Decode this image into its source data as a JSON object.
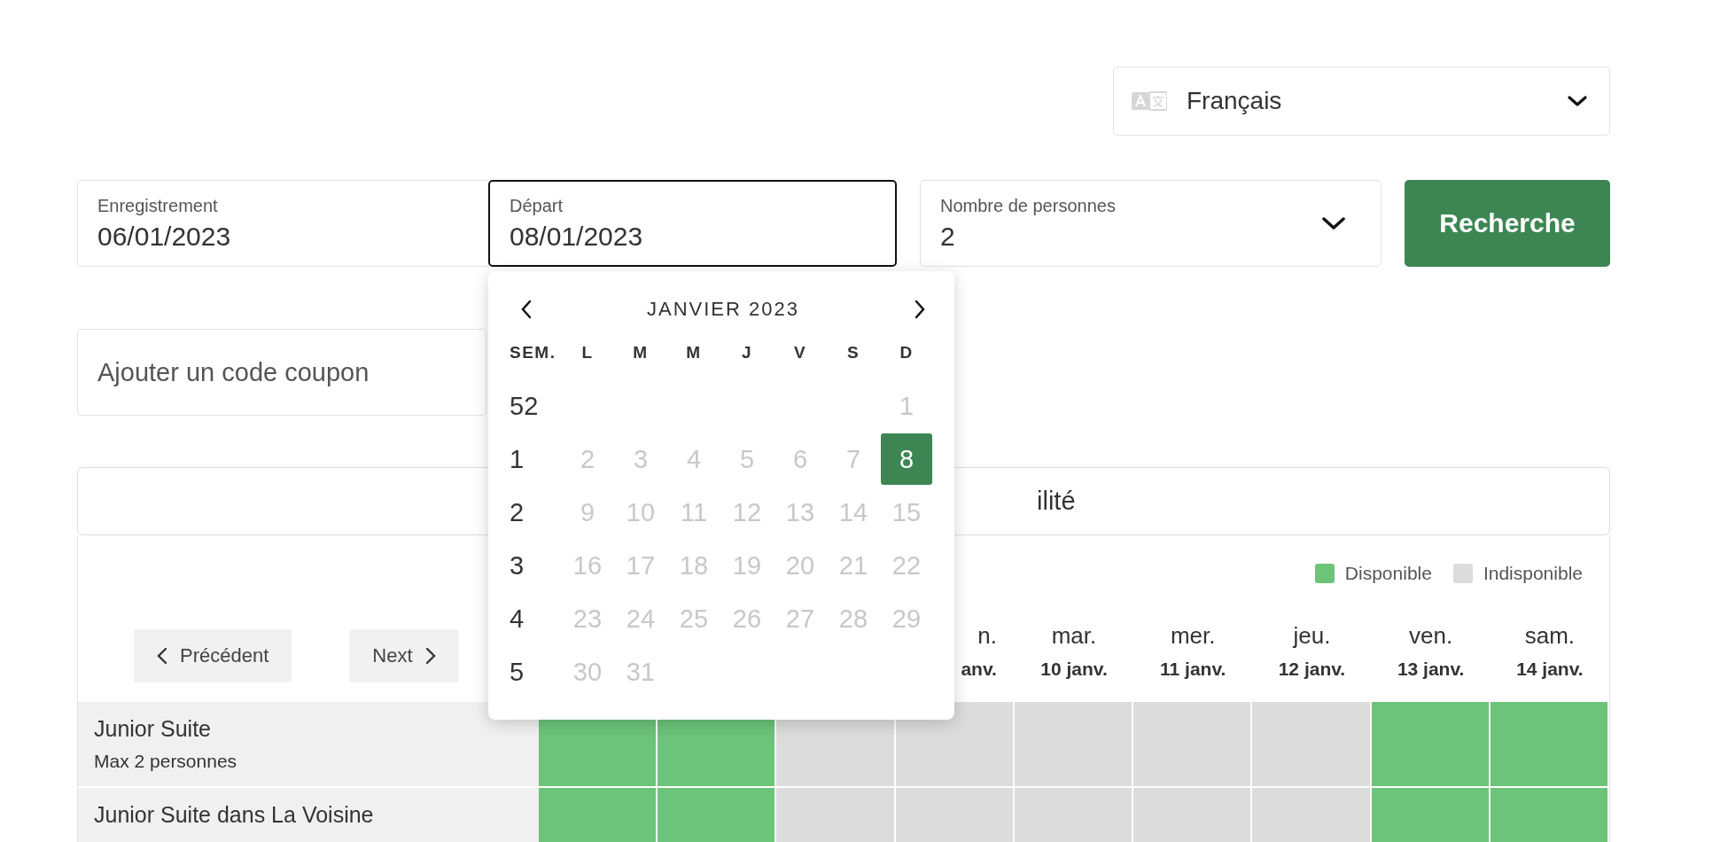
{
  "language": {
    "value": "Français"
  },
  "search_form": {
    "checkin": {
      "label": "Enregistrement",
      "value": "06/01/2023"
    },
    "checkout": {
      "label": "Départ",
      "value": "08/01/2023",
      "focused": true
    },
    "guests": {
      "label": "Nombre de personnes",
      "value": "2"
    },
    "search_button": "Recherche"
  },
  "coupon": {
    "placeholder": "Ajouter un code coupon"
  },
  "date_picker": {
    "month": "JANVIER 2023",
    "week_header": "SEM.",
    "weekdays": [
      "L",
      "M",
      "M",
      "J",
      "V",
      "S",
      "D"
    ],
    "weeks": [
      {
        "week": "52",
        "days": [
          {
            "day": "1",
            "disabled": true,
            "selected": false
          }
        ]
      },
      {
        "week": "1",
        "days": [
          {
            "day": "2",
            "disabled": true,
            "selected": false
          },
          {
            "day": "3",
            "disabled": true,
            "selected": false
          },
          {
            "day": "4",
            "disabled": true,
            "selected": false
          },
          {
            "day": "5",
            "disabled": true,
            "selected": false
          },
          {
            "day": "6",
            "disabled": true,
            "selected": false
          },
          {
            "day": "7",
            "disabled": true,
            "selected": false
          },
          {
            "day": "8",
            "disabled": false,
            "selected": true
          }
        ]
      },
      {
        "week": "2",
        "days": [
          {
            "day": "9",
            "disabled": true,
            "selected": false
          },
          {
            "day": "10",
            "disabled": true,
            "selected": false
          },
          {
            "day": "11",
            "disabled": true,
            "selected": false
          },
          {
            "day": "12",
            "disabled": true,
            "selected": false
          },
          {
            "day": "13",
            "disabled": true,
            "selected": false
          },
          {
            "day": "14",
            "disabled": true,
            "selected": false
          },
          {
            "day": "15",
            "disabled": true,
            "selected": false
          }
        ]
      },
      {
        "week": "3",
        "days": [
          {
            "day": "16",
            "disabled": true,
            "selected": false
          },
          {
            "day": "17",
            "disabled": true,
            "selected": false
          },
          {
            "day": "18",
            "disabled": true,
            "selected": false
          },
          {
            "day": "19",
            "disabled": true,
            "selected": false
          },
          {
            "day": "20",
            "disabled": true,
            "selected": false
          },
          {
            "day": "21",
            "disabled": true,
            "selected": false
          },
          {
            "day": "22",
            "disabled": true,
            "selected": false
          }
        ]
      },
      {
        "week": "4",
        "days": [
          {
            "day": "23",
            "disabled": true,
            "selected": false
          },
          {
            "day": "24",
            "disabled": true,
            "selected": false
          },
          {
            "day": "25",
            "disabled": true,
            "selected": false
          },
          {
            "day": "26",
            "disabled": true,
            "selected": false
          },
          {
            "day": "27",
            "disabled": true,
            "selected": false
          },
          {
            "day": "28",
            "disabled": true,
            "selected": false
          },
          {
            "day": "29",
            "disabled": true,
            "selected": false
          }
        ]
      },
      {
        "week": "5",
        "days": [
          {
            "day": "30",
            "disabled": true,
            "selected": false
          },
          {
            "day": "31",
            "disabled": true,
            "selected": false
          }
        ]
      }
    ]
  },
  "availability_bar": {
    "title": "ilité"
  },
  "availability": {
    "legend": [
      {
        "label": "Disponible",
        "color": "#6cc37a"
      },
      {
        "label": "Indisponible",
        "color": "#dcdcdc"
      }
    ],
    "previous_button": "Précédent",
    "next_button": "Next",
    "days": [
      {
        "weekday": "n.",
        "date": "anv."
      },
      {
        "weekday": "mar.",
        "date": "10 janv."
      },
      {
        "weekday": "mer.",
        "date": "11 janv."
      },
      {
        "weekday": "jeu.",
        "date": "12 janv."
      },
      {
        "weekday": "ven.",
        "date": "13 janv."
      },
      {
        "weekday": "sam.",
        "date": "14 janv."
      }
    ],
    "rooms": [
      {
        "name": "Junior Suite",
        "capacity": "Max 2 personnes",
        "cells": [
          {
            "available": true
          },
          {
            "available": true
          },
          {
            "available": false
          },
          {
            "available": false
          },
          {
            "available": false
          },
          {
            "available": false
          },
          {
            "available": false
          },
          {
            "available": true
          },
          {
            "available": true
          }
        ]
      },
      {
        "name": "Junior Suite dans La Voisine",
        "cells": [
          {
            "available": true
          },
          {
            "available": true
          },
          {
            "available": false
          },
          {
            "available": false
          },
          {
            "available": false
          },
          {
            "available": false
          },
          {
            "available": false
          },
          {
            "available": true
          },
          {
            "available": true
          }
        ]
      }
    ]
  }
}
